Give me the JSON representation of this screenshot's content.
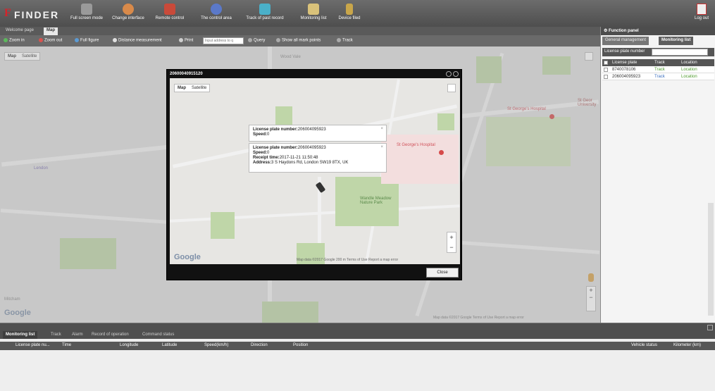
{
  "header": {
    "logo_text": "FINDER",
    "logo_mark": "F",
    "buttons": [
      {
        "label": "Full screen mode",
        "icon": "fullscreen-icon",
        "color": "#9a9a9a"
      },
      {
        "label": "Change interface",
        "icon": "palette-icon",
        "color": "#d98a4a"
      },
      {
        "label": "Remote control",
        "icon": "remote-icon",
        "color": "#c94a3a"
      },
      {
        "label": "The control area",
        "icon": "area-icon",
        "color": "#5b79c9"
      },
      {
        "label": "Track of past record",
        "icon": "track-icon",
        "color": "#4ab0c9"
      },
      {
        "label": "Monitoring list",
        "icon": "list-icon",
        "color": "#d9c27a"
      },
      {
        "label": "Device filed",
        "icon": "device-icon",
        "color": "#c9a64a"
      }
    ],
    "logout_label": "Log out"
  },
  "tabs": [
    "Welcome page",
    "Map"
  ],
  "toolbar": {
    "zoom_in": "Zoom in",
    "zoom_out": "Zoom out",
    "full_figure": "Full figure",
    "distance": "Distance measurement",
    "print": "Print",
    "input_placeholder": "Input address to q",
    "query": "Query",
    "show_all": "Show all mark points",
    "track": "Track"
  },
  "map": {
    "maptype": [
      "Map",
      "Satellite"
    ],
    "labels": [
      "Wood Vale",
      "Lendon",
      "St George's Hospital",
      "St Geor University",
      "Mitcham"
    ],
    "footer": "Map data ©2017 Google   Terms of Use   Report a map error"
  },
  "popup": {
    "title": "20600040915120",
    "maptype": [
      "Map",
      "Satellite"
    ],
    "info1": {
      "plate_label": "License plate number:",
      "plate_value": "206004095923",
      "speed_label": "Speed:",
      "speed_value": "0"
    },
    "info2": {
      "plate_label": "License plate number:",
      "plate_value": "206004095923",
      "speed_label": "Speed:",
      "speed_value": "0",
      "time_label": "Receipt time:",
      "time_value": "2017-11-21 11:50:48",
      "address_label": "Address:",
      "address_value": "3 S Haydons Rd, London SW19 8TX, UK"
    },
    "labels": [
      "St George's Hospital",
      "Wandle Meadow Nature Park"
    ],
    "footer": "Map data ©2017 Google   200 m   Terms of Use   Report a map error",
    "close_label": "Close"
  },
  "right_panel": {
    "title": "Function panel",
    "tabs": [
      "General management",
      "Monitoring list"
    ],
    "search_label": "License plate number",
    "columns": [
      "License plate",
      "Track",
      "Location"
    ],
    "rows": [
      {
        "plate": "8740078106",
        "track": "Track",
        "location": "Location"
      },
      {
        "plate": "206004095923",
        "track": "Track",
        "location": "Location"
      }
    ]
  },
  "bottom": {
    "tabs": [
      "Monitoring list",
      "Track",
      "Alarm",
      "Record of operation",
      "Command status"
    ],
    "columns": [
      "License plate nu...",
      "Time",
      "Longitude",
      "Latitude",
      "Speed(km/h)",
      "Direction",
      "Position",
      "Vehicle status",
      "Kilometer (km)"
    ]
  }
}
